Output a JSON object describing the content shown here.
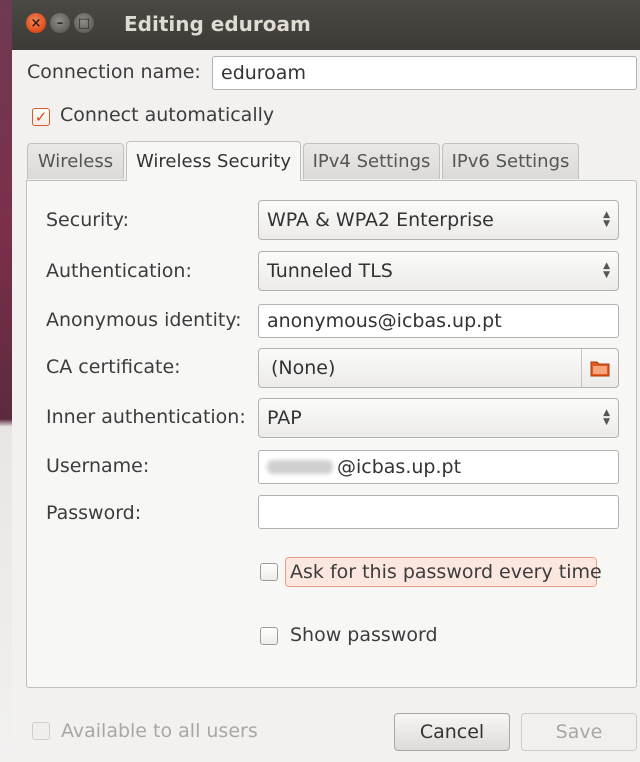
{
  "window": {
    "title": "Editing eduroam",
    "close_glyph": "×",
    "min_glyph": "–",
    "max_glyph": "□"
  },
  "connection": {
    "name_label": "Connection name:",
    "name_value": "eduroam",
    "auto_label": "Connect automatically",
    "auto_checked": true
  },
  "tabs": [
    {
      "label": "Wireless",
      "active": false
    },
    {
      "label": "Wireless Security",
      "active": true
    },
    {
      "label": "IPv4 Settings",
      "active": false
    },
    {
      "label": "IPv6 Settings",
      "active": false
    }
  ],
  "security": {
    "security_label": "Security:",
    "security_value": "WPA & WPA2 Enterprise",
    "auth_label": "Authentication:",
    "auth_value": "Tunneled TLS",
    "anon_label": "Anonymous identity:",
    "anon_value": "anonymous@icbas.up.pt",
    "ca_label": "CA certificate:",
    "ca_value": "(None)",
    "inner_label": "Inner authentication:",
    "inner_value": "PAP",
    "username_label": "Username:",
    "username_value": "@icbas.up.pt",
    "password_label": "Password:",
    "password_value": "",
    "ask_label": "Ask for this password every time",
    "show_label": "Show password"
  },
  "footer": {
    "all_users_label": "Available to all users",
    "cancel_label": "Cancel",
    "save_label": "Save"
  },
  "colors": {
    "accent": "#dd4814",
    "titlebar": "#3c3b37",
    "highlight_bg": "#fbe7df"
  },
  "icons": {
    "close": "close-icon",
    "minimize": "minimize-icon",
    "maximize": "maximize-icon",
    "folder": "folder-icon",
    "combo": "combo-arrows-icon"
  }
}
